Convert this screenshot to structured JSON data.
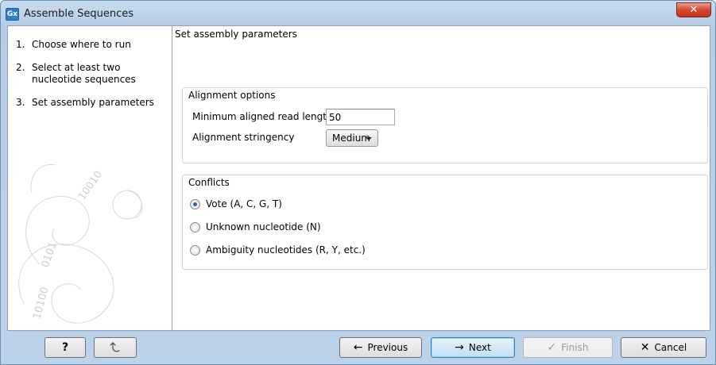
{
  "window": {
    "title": "Assemble Sequences",
    "icon_label": "Gx",
    "close_glyph": "✕"
  },
  "sidebar": {
    "steps": [
      {
        "num": "1.",
        "label": "Choose where to run"
      },
      {
        "num": "2.",
        "label": "Select at least two nucleotide sequences"
      },
      {
        "num": "3.",
        "label": "Set assembly parameters"
      }
    ]
  },
  "main": {
    "heading": "Set assembly parameters",
    "alignment": {
      "title": "Alignment options",
      "min_length_label": "Minimum aligned read length",
      "min_length_value": "50",
      "stringency_label": "Alignment stringency",
      "stringency_value": "Medium"
    },
    "conflicts": {
      "title": "Conflicts",
      "options": [
        {
          "label": "Vote (A, C, G, T)",
          "checked": true
        },
        {
          "label": "Unknown nucleotide (N)",
          "checked": false
        },
        {
          "label": "Ambiguity nucleotides (R, Y, etc.)",
          "checked": false
        }
      ]
    }
  },
  "footer": {
    "help_label": "?",
    "previous_label": "Previous",
    "next_label": "Next",
    "finish_label": "Finish",
    "cancel_label": "Cancel"
  }
}
